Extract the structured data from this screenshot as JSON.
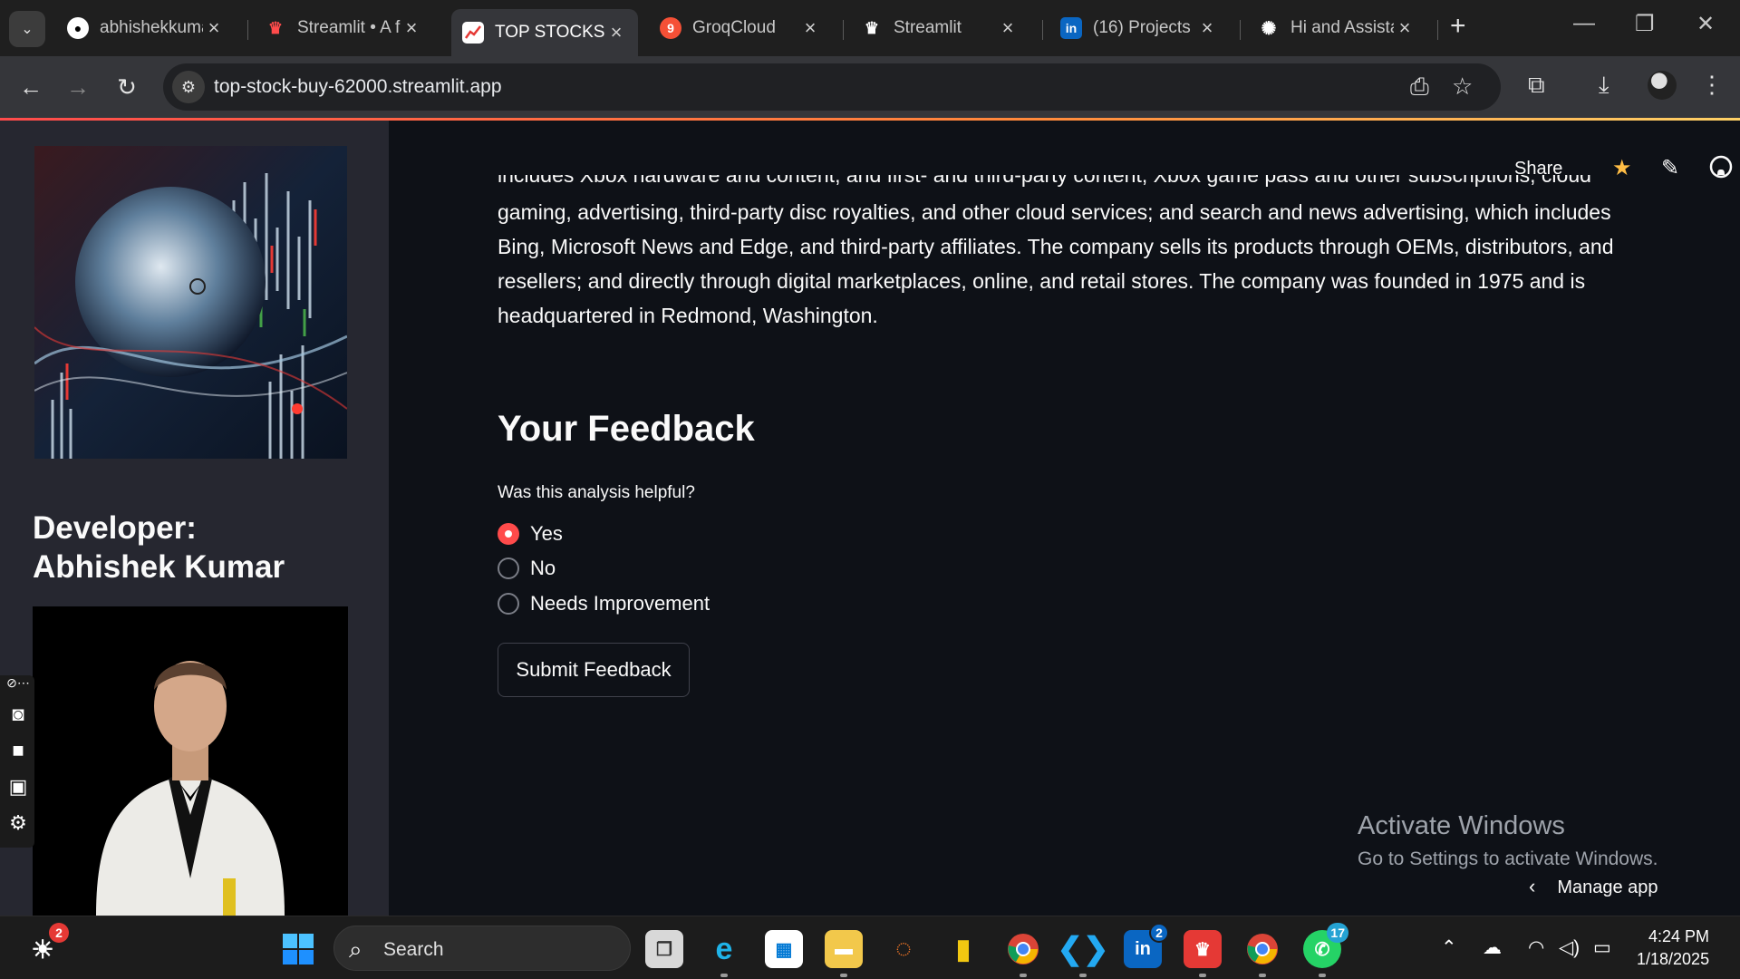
{
  "browser": {
    "tabs": [
      {
        "label": "abhishekkuma",
        "favicon": "github-icon"
      },
      {
        "label": "Streamlit • A f",
        "favicon": "streamlit-icon"
      },
      {
        "label": "TOP STOCKS F",
        "favicon": "chart-icon"
      },
      {
        "label": "GroqCloud",
        "favicon": "groq-icon",
        "favicon_text": "9"
      },
      {
        "label": "Streamlit",
        "favicon": "streamlit-crown-icon"
      },
      {
        "label": "(16) Projects |",
        "favicon": "linkedin-icon",
        "favicon_text": "in"
      },
      {
        "label": "Hi and Assista",
        "favicon": "openai-icon"
      }
    ],
    "active_tab_index": 2,
    "url": "top-stock-buy-62000.streamlit.app"
  },
  "sidebar": {
    "developer_heading": "Developer: Abhishek Kumar"
  },
  "header": {
    "share_label": "Share"
  },
  "main": {
    "description_cut_line": "includes Xbox hardware and content, and first- and third-party content, Xbox game pass and other subscriptions, cloud",
    "description_lines": [
      "gaming, advertising, third-party disc royalties, and other cloud services; and search and news advertising, which includes",
      "Bing, Microsoft News and Edge, and third-party affiliates. The company sells its products through OEMs, distributors, and",
      "resellers; and directly through digital marketplaces, online, and retail stores. The company was founded in 1975 and is",
      "headquartered in Redmond, Washington."
    ],
    "feedback_title": "Your Feedback",
    "question": "Was this analysis helpful?",
    "options": [
      "Yes",
      "No",
      "Needs Improvement"
    ],
    "selected_option": "Yes",
    "submit_label": "Submit Feedback"
  },
  "overlay": {
    "activate_title": "Activate Windows",
    "activate_subtitle": "Go to Settings to activate Windows.",
    "manage_app": "Manage app"
  },
  "taskbar": {
    "search_placeholder": "Search",
    "weather_badge": "2",
    "linkedin_badge": "2",
    "whatsapp_badge": "17",
    "time": "4:24 PM",
    "date": "1/18/2025"
  },
  "colors": {
    "accent": "#ff4b4b",
    "app_background": "#0e1117",
    "sidebar_background": "#262730",
    "text": "#fafafa"
  }
}
